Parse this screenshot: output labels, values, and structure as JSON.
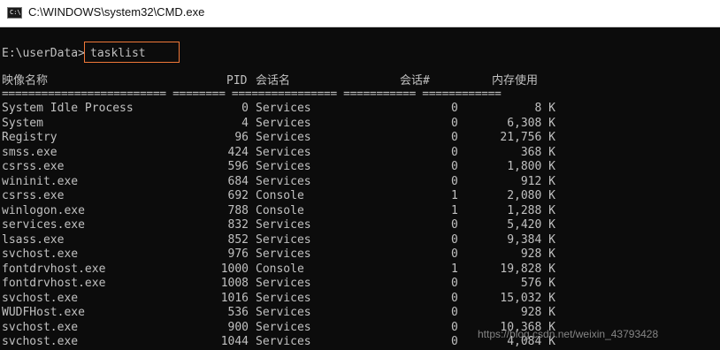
{
  "window": {
    "title": "C:\\WINDOWS\\system32\\CMD.exe",
    "icon": "cmd-icon",
    "icon_text": "C:\\"
  },
  "prompt": {
    "path": "E:\\userData>",
    "command": "tasklist"
  },
  "headers": {
    "image_name": "映像名称",
    "pid": "PID",
    "session_name": "会话名",
    "session_num": "会话#",
    "mem_usage": "内存使用"
  },
  "separator": "========================= ======== ================ =========== ============",
  "rows": [
    {
      "name": "System Idle Process",
      "pid": "0",
      "session": "Services",
      "num": "0",
      "mem": "8 K"
    },
    {
      "name": "System",
      "pid": "4",
      "session": "Services",
      "num": "0",
      "mem": "6,308 K"
    },
    {
      "name": "Registry",
      "pid": "96",
      "session": "Services",
      "num": "0",
      "mem": "21,756 K"
    },
    {
      "name": "smss.exe",
      "pid": "424",
      "session": "Services",
      "num": "0",
      "mem": "368 K"
    },
    {
      "name": "csrss.exe",
      "pid": "596",
      "session": "Services",
      "num": "0",
      "mem": "1,800 K"
    },
    {
      "name": "wininit.exe",
      "pid": "684",
      "session": "Services",
      "num": "0",
      "mem": "912 K"
    },
    {
      "name": "csrss.exe",
      "pid": "692",
      "session": "Console",
      "num": "1",
      "mem": "2,080 K"
    },
    {
      "name": "winlogon.exe",
      "pid": "788",
      "session": "Console",
      "num": "1",
      "mem": "1,288 K"
    },
    {
      "name": "services.exe",
      "pid": "832",
      "session": "Services",
      "num": "0",
      "mem": "5,420 K"
    },
    {
      "name": "lsass.exe",
      "pid": "852",
      "session": "Services",
      "num": "0",
      "mem": "9,384 K"
    },
    {
      "name": "svchost.exe",
      "pid": "976",
      "session": "Services",
      "num": "0",
      "mem": "928 K"
    },
    {
      "name": "fontdrvhost.exe",
      "pid": "1000",
      "session": "Console",
      "num": "1",
      "mem": "19,828 K"
    },
    {
      "name": "fontdrvhost.exe",
      "pid": "1008",
      "session": "Services",
      "num": "0",
      "mem": "576 K"
    },
    {
      "name": "svchost.exe",
      "pid": "1016",
      "session": "Services",
      "num": "0",
      "mem": "15,032 K"
    },
    {
      "name": "WUDFHost.exe",
      "pid": "536",
      "session": "Services",
      "num": "0",
      "mem": "928 K"
    },
    {
      "name": "svchost.exe",
      "pid": "900",
      "session": "Services",
      "num": "0",
      "mem": "10,368 K"
    },
    {
      "name": "svchost.exe",
      "pid": "1044",
      "session": "Services",
      "num": "0",
      "mem": "4,084 K"
    }
  ],
  "watermark": "https://blog.csdn.net/weixin_43793428"
}
